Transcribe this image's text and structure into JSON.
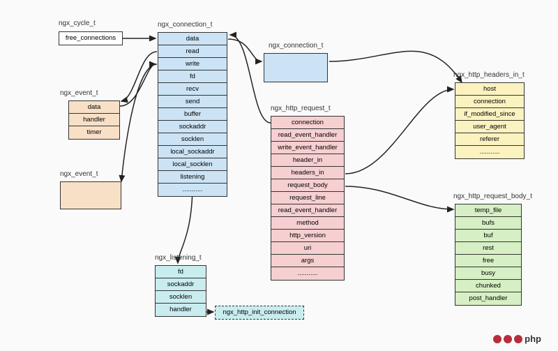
{
  "structs": {
    "cycle": {
      "title": "ngx_cycle_t",
      "rows": [
        "free_connections"
      ]
    },
    "event1": {
      "title": "ngx_event_t",
      "rows": [
        "data",
        "handler",
        "timer"
      ]
    },
    "event2": {
      "title": "ngx_event_t",
      "rows": []
    },
    "conn1": {
      "title": "ngx_connection_t",
      "rows": [
        "data",
        "read",
        "write",
        "fd",
        "recv",
        "send",
        "buffer",
        "sockaddr",
        "socklen",
        "local_sockaddr",
        "local_socklen",
        "listening",
        "..........."
      ]
    },
    "conn2": {
      "title": "ngx_connection_t",
      "rows": []
    },
    "request": {
      "title": "ngx_http_request_t",
      "rows": [
        "connection",
        "read_event_handler",
        "write_event_handler",
        "header_in",
        "headers_in",
        "request_body",
        "request_line",
        "read_event_handler",
        "method",
        "http_version",
        "uri",
        "args",
        "..........."
      ]
    },
    "headers_in": {
      "title": "ngx_http_headers_in_t",
      "rows": [
        "host",
        "connection",
        "if_modified_since",
        "user_agent",
        "referer",
        "..........."
      ]
    },
    "request_body": {
      "title": "ngx_http_request_body_t",
      "rows": [
        "temp_file",
        "bufs",
        "buf",
        "rest",
        "free",
        "busy",
        "chunked",
        "post_handler"
      ]
    },
    "listening": {
      "title": "ngx_listening_t",
      "rows": [
        "fd",
        "sockaddr",
        "socklen",
        "handler"
      ]
    },
    "handler_target": {
      "title": "",
      "rows": [
        "ngx_http_init_connection"
      ]
    }
  },
  "logo": {
    "text": "php"
  }
}
